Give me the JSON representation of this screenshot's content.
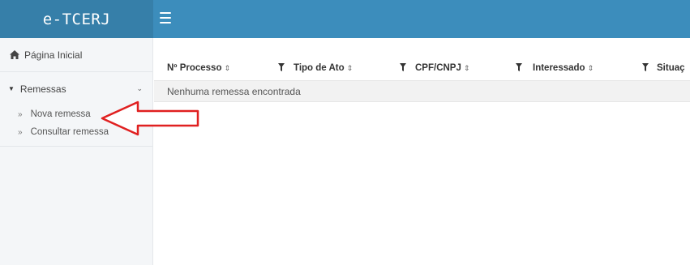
{
  "header": {
    "logo": "e-TCERJ"
  },
  "sidebar": {
    "home_label": "Página Inicial",
    "group_label": "Remessas",
    "items": [
      {
        "label": "Nova remessa"
      },
      {
        "label": "Consultar remessa"
      }
    ]
  },
  "table": {
    "columns": [
      {
        "label": "Nº Processo"
      },
      {
        "label": "Tipo de Ato"
      },
      {
        "label": "CPF/CNPJ"
      },
      {
        "label": "Interessado"
      },
      {
        "label": "Situaç"
      }
    ],
    "sort_glyph": "⇕",
    "empty_message": "Nenhuma remessa encontrada"
  },
  "glyphs": {
    "caret": "▼",
    "chevron": "⌄",
    "double_chevron": "»"
  },
  "colors": {
    "topbar": "#3c8dbc",
    "logo_bg": "#367fa9",
    "annotation_arrow": "#e02020"
  }
}
